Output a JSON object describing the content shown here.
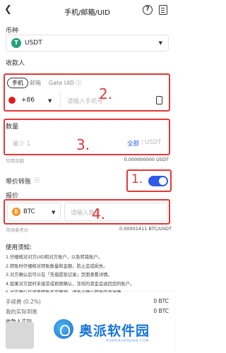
{
  "header": {
    "title": "手机/邮箱/UID",
    "help_label": "?"
  },
  "currency": {
    "label": "币种",
    "coin_symbol": "T",
    "coin": "USDT"
  },
  "recipient": {
    "label": "收款人",
    "tabs": [
      {
        "label": "手机",
        "active": true
      },
      {
        "label": "邮箱",
        "active": false
      },
      {
        "label": "Gate UID ⓘ",
        "active": false
      }
    ],
    "country_code": "+86",
    "phone_placeholder": "请输入手机号",
    "annotation": "2."
  },
  "amount": {
    "label": "数量",
    "placeholder": "最少 1",
    "all_label": "全部",
    "unit": "USDT",
    "annotation": "3.",
    "available_label": "可用余额",
    "available_value": "0.000000000 USDT"
  },
  "price_transfer": {
    "label": "带价转账",
    "info": "ⓘ",
    "enabled": true,
    "annotation": "1."
  },
  "quote": {
    "label": "报价",
    "coin_symbol": "₿",
    "coin": "BTC",
    "placeholder": "请输入数量",
    "annotation": "4.",
    "unit_price_label": "市场参考价",
    "unit_price_value": "0.00001411 BTC/USDT"
  },
  "notes": {
    "title": "使用须知:",
    "items": [
      "1.仔细核对对方UID和对方账户，以免转错账户。",
      "2.转账时仔细核对转账数量和金额，防止造成损失。",
      "3.对方确认后可以在「充值提现记录」页面查看详情。",
      "4.如果对方超时未接受或拒绝确认，冻结的资金会退回您的账户。",
      "5.对方确认后该笔转账不可撤销，请务必确认转账信息准确。"
    ]
  },
  "footer": {
    "fee_label": "手续费 (0.2%)",
    "fee_value": "0 BTC",
    "actual_label": "我的实际到账",
    "actual_value": "0 BTC",
    "receive_label": "收款人实际"
  },
  "watermark": {
    "name": "奥派软件园",
    "url": "AOPAIRUANJIAN.COM"
  },
  "colors": {
    "annotation_red": "#e23838",
    "toggle_blue": "#2f5bea",
    "usdt_green": "#26a17b",
    "btc_orange": "#f7931a"
  }
}
